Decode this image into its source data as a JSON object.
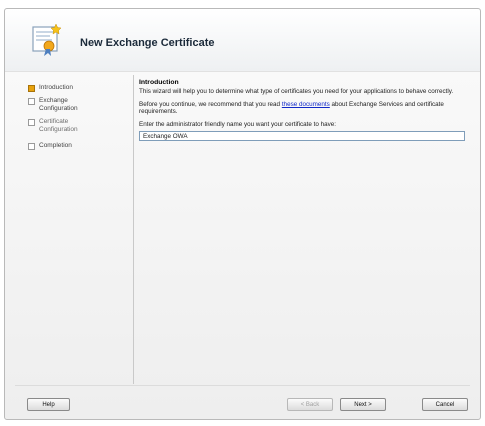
{
  "window": {
    "title": "New Exchange Certificate"
  },
  "steps": [
    {
      "label": "Introduction",
      "state": "active"
    },
    {
      "label": "Exchange Configuration",
      "state": "pending"
    },
    {
      "label": "Certificate Configuration",
      "state": "disabled"
    },
    {
      "label": "Completion",
      "state": "pending"
    }
  ],
  "content": {
    "heading": "Introduction",
    "intro_text": "This wizard will help you to determine what type of certificates you need for your applications to behave correctly.",
    "recommend_before": "Before you continue, we recommend that you read ",
    "recommend_link": "these documents",
    "recommend_after": " about Exchange Services and certificate requirements.",
    "name_prompt": "Enter the administrator friendly name you want your certificate to have:",
    "friendly_name_value": "Exchange OWA"
  },
  "buttons": {
    "help": "Help",
    "back": "< Back",
    "next": "Next >",
    "cancel": "Cancel"
  },
  "colors": {
    "active_step": "#e8a20c",
    "link": "#1028c8"
  },
  "icons": {
    "header": "certificate-wizard-icon"
  }
}
